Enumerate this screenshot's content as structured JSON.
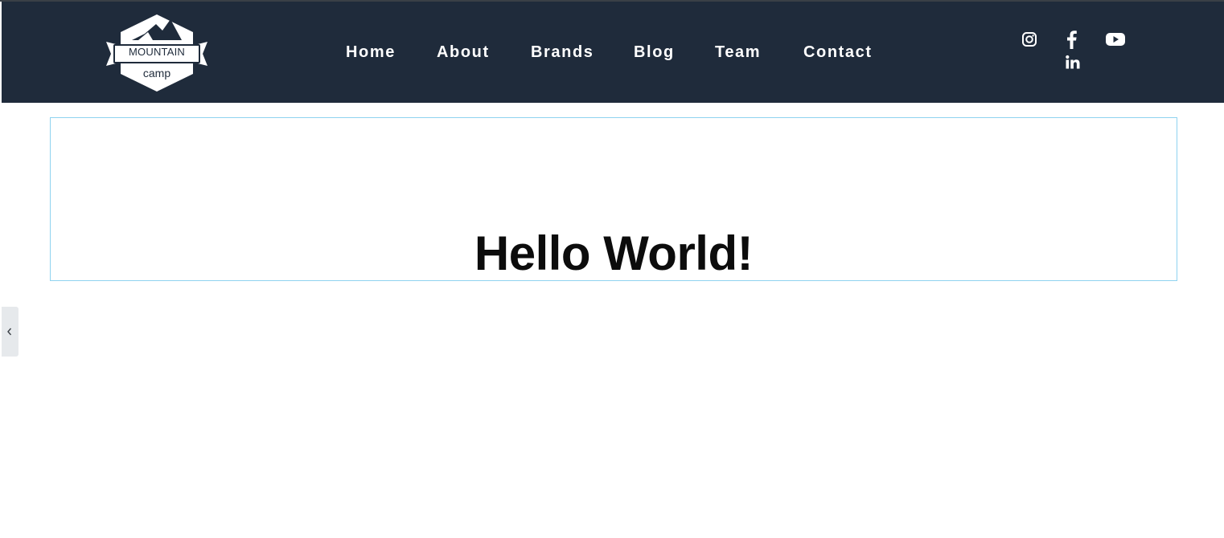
{
  "brand": {
    "logo_text_top": "MOUNTAIN",
    "logo_text_bottom": "camp"
  },
  "nav": {
    "items": [
      {
        "label": "Home"
      },
      {
        "label": "About"
      },
      {
        "label": "Brands"
      },
      {
        "label": "Blog"
      },
      {
        "label": "Team"
      },
      {
        "label": "Contact"
      }
    ]
  },
  "social": {
    "icons": [
      "instagram-icon",
      "facebook-icon",
      "youtube-icon",
      "linkedin-icon"
    ]
  },
  "main": {
    "heading": "Hello World!"
  },
  "panel_toggle": {
    "icon": "chevron-left-icon"
  },
  "colors": {
    "header_bg": "#1f2b3b",
    "header_text": "#ffffff",
    "box_border": "#8fd3f0",
    "heading_text": "#0c0c0c"
  }
}
